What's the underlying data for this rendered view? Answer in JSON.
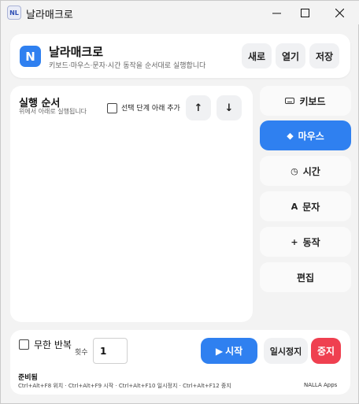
{
  "window": {
    "title": "날라매크로",
    "app_icon_text": "NL"
  },
  "header": {
    "logo_letter": "N",
    "app_name": "날라매크로",
    "subtitle": "키보드·마우스·문자·시간 동작을 순서대로 실행합니다",
    "buttons": {
      "new": "새로",
      "open": "열기",
      "save": "저장"
    }
  },
  "sequence": {
    "title": "실행 순서",
    "subtitle": "위에서 아래로 실행됩니다",
    "add_below_label": "선택 단계 아래 추가",
    "add_below_checked": false,
    "move_up_icon": "↑",
    "move_down_icon": "↓"
  },
  "side_buttons": {
    "keyboard": {
      "label": "키보드",
      "icon": "keyboard-icon"
    },
    "mouse": {
      "label": "마우스",
      "icon": "◆",
      "active": true
    },
    "time": {
      "label": "시간",
      "icon": "◷"
    },
    "text": {
      "label": "문자",
      "icon": "A"
    },
    "action": {
      "label": "동작",
      "icon": "+"
    },
    "edit": {
      "label": "편집"
    }
  },
  "bottom": {
    "infinite_loop_label": "무한 반복",
    "infinite_loop_checked": false,
    "count_label": "횟수",
    "count_value": "1",
    "start_icon": "▶",
    "start_label": "시작",
    "pause_label": "일시정지",
    "stop_label": "중지",
    "status": "준비됨",
    "hotkeys": "Ctrl+Alt+F8 위치 · Ctrl+Alt+F9 시작 · Ctrl+Alt+F10 일시정지 · Ctrl+Alt+F12 중지",
    "brand": "NALLA Apps"
  },
  "colors": {
    "accent": "#2f80f0",
    "stop": "#ef4050",
    "background": "#f3f3f3",
    "card": "#ffffff"
  }
}
